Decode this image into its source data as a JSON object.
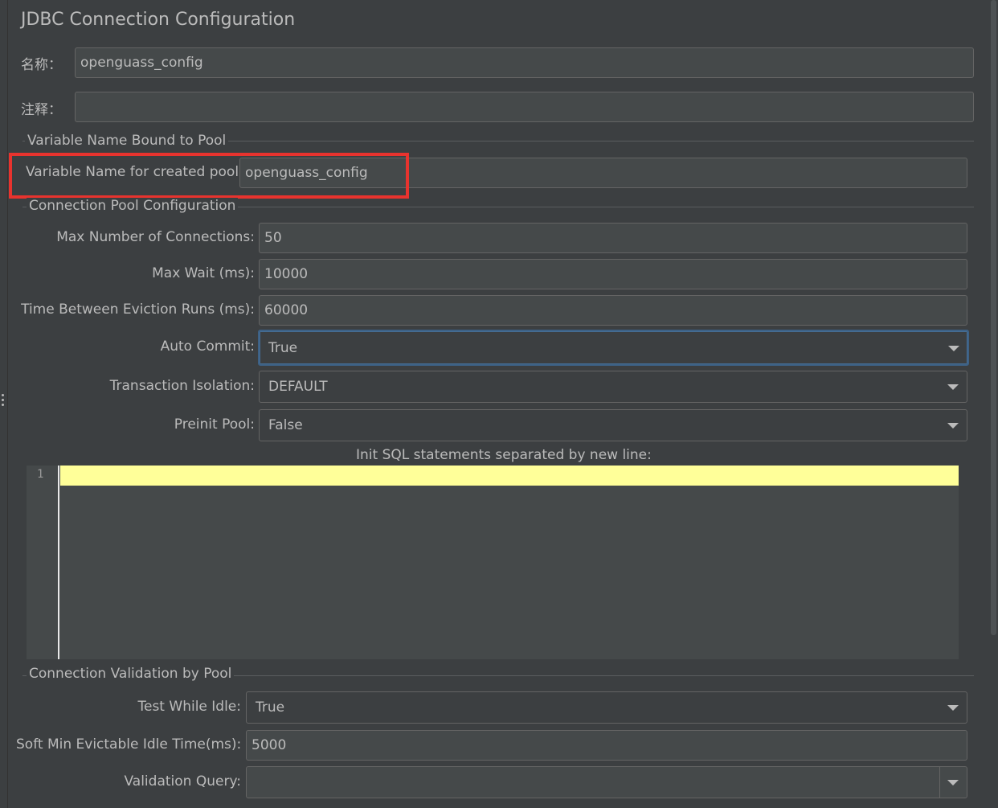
{
  "title": "JDBC Connection Configuration",
  "name_label": "名称：",
  "name_value": "openguass_config",
  "comment_label": "注释：",
  "comment_value": "",
  "groups": {
    "variable": "Variable Name Bound to Pool",
    "pool": "Connection Pool Configuration",
    "validation": "Connection Validation by Pool"
  },
  "variable_name": {
    "label": "Variable Name for created pool:",
    "value": "openguass_config"
  },
  "pool": {
    "max_connections": {
      "label": "Max Number of Connections:",
      "value": "50"
    },
    "max_wait": {
      "label": "Max Wait (ms):",
      "value": "10000"
    },
    "eviction": {
      "label": "Time Between Eviction Runs (ms):",
      "value": "60000"
    },
    "auto_commit": {
      "label": "Auto Commit:",
      "value": "True"
    },
    "isolation": {
      "label": "Transaction Isolation:",
      "value": "DEFAULT"
    },
    "preinit": {
      "label": "Preinit Pool:",
      "value": "False"
    }
  },
  "init_sql": {
    "label": "Init SQL statements separated by new line:",
    "line_number": "1"
  },
  "validation": {
    "test_idle": {
      "label": "Test While Idle:",
      "value": "True"
    },
    "soft_min": {
      "label": "Soft Min Evictable Idle Time(ms):",
      "value": "5000"
    },
    "query": {
      "label": "Validation Query:",
      "value": ""
    }
  },
  "colors": {
    "highlight": "#e8332e",
    "current_line": "#ffff99",
    "focus": "#3d6185"
  }
}
